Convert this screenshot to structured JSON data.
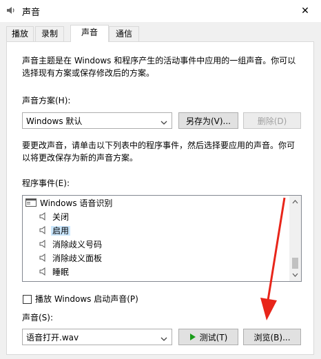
{
  "window": {
    "title": "声音",
    "close_glyph": "✕"
  },
  "tabs": [
    {
      "label": "播放"
    },
    {
      "label": "录制"
    },
    {
      "label": "声音"
    },
    {
      "label": "通信"
    }
  ],
  "intro_line1": "声音主题是在 Windows 和程序产生的活动事件中应用的一组声音。你可以",
  "intro_line2": "选择现有方案或保存修改后的方案。",
  "scheme": {
    "label": "声音方案(H):",
    "value": "Windows 默认",
    "save_as": "另存为(V)...",
    "delete": "删除(D)"
  },
  "change_line1": "要更改声音，请单击以下列表中的程序事件，然后选择要应用的声音。你可",
  "change_line2": "以将更改保存为新的声音方案。",
  "events": {
    "label": "程序事件(E):",
    "group": "Windows 语音识别",
    "items": [
      "关闭",
      "启用",
      "消除歧义号码",
      "消除歧义面板",
      "睡眠"
    ]
  },
  "startup_sound_label": "播放 Windows 启动声音(P)",
  "sound": {
    "label": "声音(S):",
    "value": "语音打开.wav",
    "test": "测试(T)",
    "browse": "浏览(B)..."
  },
  "colors": {
    "selection": "#cce8ff",
    "annotation_arrow": "#e8251a"
  }
}
